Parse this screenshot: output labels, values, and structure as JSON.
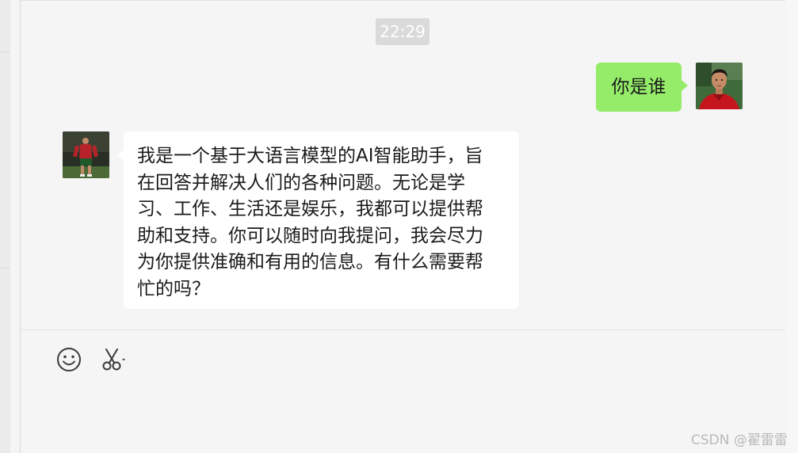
{
  "chat": {
    "timestamp": "22:29",
    "messages": [
      {
        "sender": "self",
        "text": "你是谁"
      },
      {
        "sender": "bot",
        "text": "我是一个基于大语言模型的AI智能助手，旨\n在回答并解决人们的各种问题。无论是学\n习、工作、生活还是娱乐，我都可以提供帮\n助和支持。你可以随时向我提问，我会尽力\n为你提供准确和有用的信息。有什么需要帮\n忙的吗？"
      }
    ]
  },
  "toolbar": {
    "icons": [
      "emoji-icon",
      "scissors-icon"
    ]
  },
  "watermark": "CSDN @翟雷雷",
  "colors": {
    "self_bubble": "#95ec69",
    "bot_bubble": "#ffffff",
    "background": "#f5f5f5",
    "timestamp_bg": "#dadada"
  }
}
